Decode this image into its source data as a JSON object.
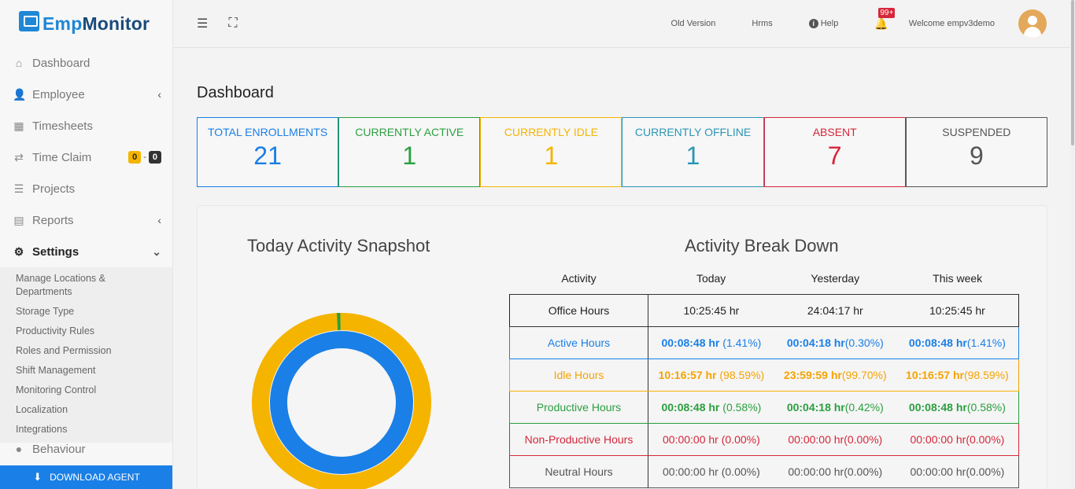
{
  "brand": {
    "prefix": "Emp",
    "suffix": "Monitor"
  },
  "sidebar": {
    "items": [
      {
        "label": "Dashboard"
      },
      {
        "label": "Employee"
      },
      {
        "label": "Timesheets"
      },
      {
        "label": "Time Claim",
        "badge_left": "0",
        "badge_right": "0"
      },
      {
        "label": "Projects"
      },
      {
        "label": "Reports"
      },
      {
        "label": "Settings"
      }
    ],
    "settings_sub": [
      "Manage Locations & Departments",
      "Storage Type",
      "Productivity Rules",
      "Roles and Permission",
      "Shift Management",
      "Monitoring Control",
      "Localization",
      "Integrations"
    ],
    "next_item_partial": "Behaviour",
    "download_label": "DOWNLOAD AGENT"
  },
  "topbar": {
    "old_version": "Old Version",
    "hrms": "Hrms",
    "help": "Help",
    "notification_count": "99+",
    "welcome": "Welcome  empv3demo"
  },
  "page": {
    "title": "Dashboard"
  },
  "stats": [
    {
      "label": "TOTAL ENROLLMENTS",
      "value": "21",
      "color": "#1a7fe6"
    },
    {
      "label": "CURRENTLY ACTIVE",
      "value": "1",
      "color": "#2a9f3f"
    },
    {
      "label": "CURRENTLY IDLE",
      "value": "1",
      "color": "#f5b400"
    },
    {
      "label": "CURRENTLY OFFLINE",
      "value": "1",
      "color": "#2a96b5"
    },
    {
      "label": "ABSENT",
      "value": "7",
      "color": "#d6263a"
    },
    {
      "label": "SUSPENDED",
      "value": "9",
      "color": "#555555"
    }
  ],
  "snapshot": {
    "title": "Today Activity Snapshot",
    "colors": {
      "productive": "#2a9f3f",
      "idle": "#f5b400",
      "active": "#1a7fe6"
    }
  },
  "breakdown": {
    "title": "Activity Break Down",
    "headers": [
      "Activity",
      "Today",
      "Yesterday",
      "This week"
    ],
    "rows": [
      {
        "label": "Office Hours",
        "today": "10:25:45 hr",
        "today_pct": "",
        "yesterday": "24:04:17 hr",
        "yesterday_pct": "",
        "week": "10:25:45 hr",
        "week_pct": ""
      },
      {
        "label": "Active Hours",
        "today": "00:08:48 hr",
        "today_pct": " (1.41%)",
        "yesterday": "00:04:18 hr",
        "yesterday_pct": "(0.30%)",
        "week": "00:08:48 hr",
        "week_pct": "(1.41%)"
      },
      {
        "label": "Idle Hours",
        "today": "10:16:57 hr",
        "today_pct": " (98.59%)",
        "yesterday": "23:59:59 hr",
        "yesterday_pct": "(99.70%)",
        "week": "10:16:57 hr",
        "week_pct": "(98.59%)"
      },
      {
        "label": "Productive Hours",
        "today": "00:08:48 hr",
        "today_pct": " (0.58%)",
        "yesterday": "00:04:18 hr",
        "yesterday_pct": "(0.42%)",
        "week": "00:08:48 hr",
        "week_pct": "(0.58%)"
      },
      {
        "label": "Non-Productive Hours",
        "today": "00:00:00 hr",
        "today_pct": " (0.00%)",
        "yesterday": "00:00:00 hr",
        "yesterday_pct": "(0.00%)",
        "week": "00:00:00 hr",
        "week_pct": "(0.00%)"
      },
      {
        "label": "Neutral Hours",
        "today": "00:00:00 hr",
        "today_pct": " (0.00%)",
        "yesterday": "00:00:00 hr",
        "yesterday_pct": "(0.00%)",
        "week": "00:00:00 hr",
        "week_pct": "(0.00%)"
      }
    ]
  }
}
